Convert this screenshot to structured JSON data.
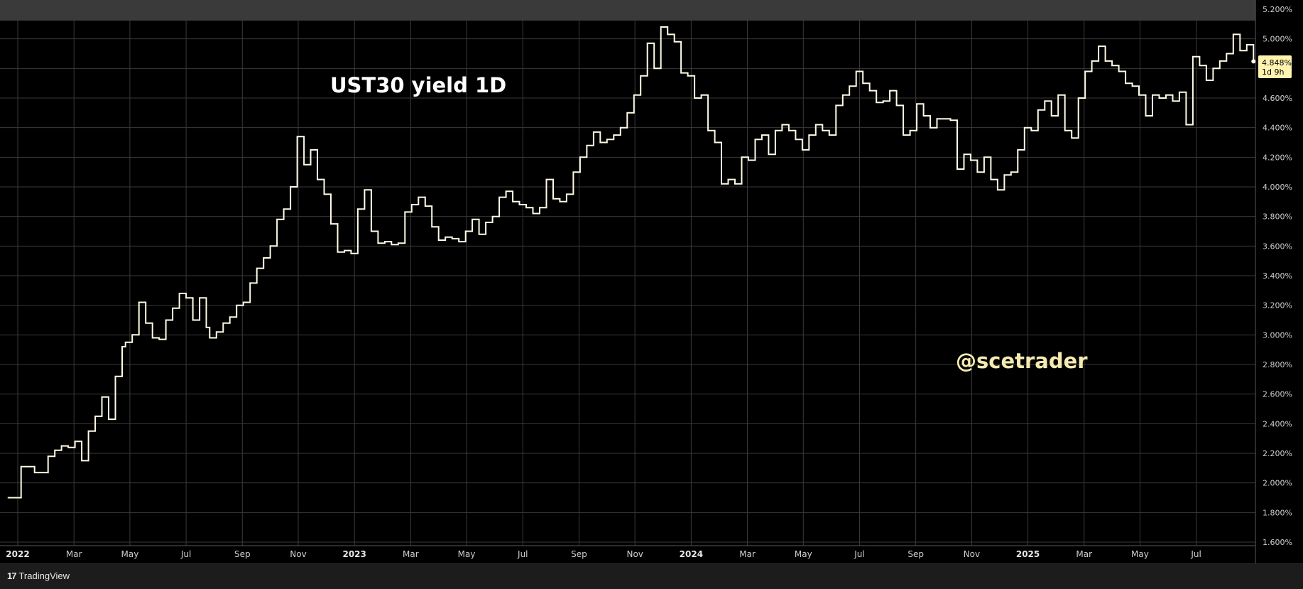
{
  "footer": {
    "brand": "TradingView",
    "brand_mark": "17"
  },
  "price_badge": {
    "value": "4.848%",
    "countdown": "1d 9h",
    "color": "#fff3b0"
  },
  "colors": {
    "background": "#000000",
    "line": "#fffbe6",
    "watermark": "#f5eab0",
    "grid": "#3a3a3a"
  },
  "chart_data": {
    "type": "line",
    "title": "UST30 yield  1D",
    "watermark": "@scetrader",
    "step": true,
    "xlim": [
      2022.0,
      2025.68
    ],
    "ylim": [
      1.6,
      5.2
    ],
    "grid": true,
    "x_ticks": [
      {
        "x": 2022.0,
        "label": "2022",
        "bold": true
      },
      {
        "x": 2022.167,
        "label": "Mar"
      },
      {
        "x": 2022.333,
        "label": "May"
      },
      {
        "x": 2022.5,
        "label": "Jul"
      },
      {
        "x": 2022.667,
        "label": "Sep"
      },
      {
        "x": 2022.833,
        "label": "Nov"
      },
      {
        "x": 2023.0,
        "label": "2023",
        "bold": true
      },
      {
        "x": 2023.167,
        "label": "Mar"
      },
      {
        "x": 2023.333,
        "label": "May"
      },
      {
        "x": 2023.5,
        "label": "Jul"
      },
      {
        "x": 2023.667,
        "label": "Sep"
      },
      {
        "x": 2023.833,
        "label": "Nov"
      },
      {
        "x": 2024.0,
        "label": "2024",
        "bold": true
      },
      {
        "x": 2024.167,
        "label": "Mar"
      },
      {
        "x": 2024.333,
        "label": "May"
      },
      {
        "x": 2024.5,
        "label": "Jul"
      },
      {
        "x": 2024.667,
        "label": "Sep"
      },
      {
        "x": 2024.833,
        "label": "Nov"
      },
      {
        "x": 2025.0,
        "label": "2025",
        "bold": true
      },
      {
        "x": 2025.167,
        "label": "Mar"
      },
      {
        "x": 2025.333,
        "label": "May"
      },
      {
        "x": 2025.5,
        "label": "Jul"
      }
    ],
    "y_ticks": [
      "1.600%",
      "1.800%",
      "2.000%",
      "2.200%",
      "2.400%",
      "2.600%",
      "2.800%",
      "3.000%",
      "3.200%",
      "3.400%",
      "3.600%",
      "3.800%",
      "4.000%",
      "4.200%",
      "4.400%",
      "4.600%",
      "4.800%",
      "5.000%",
      "5.200%"
    ],
    "series": [
      {
        "values": [
          [
            2021.97,
            1.9
          ],
          [
            2022.01,
            2.11
          ],
          [
            2022.05,
            2.07
          ],
          [
            2022.09,
            2.18
          ],
          [
            2022.11,
            2.22
          ],
          [
            2022.13,
            2.25
          ],
          [
            2022.15,
            2.24
          ],
          [
            2022.17,
            2.28
          ],
          [
            2022.19,
            2.15
          ],
          [
            2022.21,
            2.35
          ],
          [
            2022.23,
            2.45
          ],
          [
            2022.25,
            2.58
          ],
          [
            2022.27,
            2.43
          ],
          [
            2022.29,
            2.72
          ],
          [
            2022.31,
            2.92
          ],
          [
            2022.32,
            2.95
          ],
          [
            2022.34,
            3.0
          ],
          [
            2022.36,
            3.22
          ],
          [
            2022.38,
            3.08
          ],
          [
            2022.4,
            2.98
          ],
          [
            2022.42,
            2.97
          ],
          [
            2022.44,
            3.1
          ],
          [
            2022.46,
            3.18
          ],
          [
            2022.48,
            3.28
          ],
          [
            2022.5,
            3.25
          ],
          [
            2022.52,
            3.1
          ],
          [
            2022.54,
            3.25
          ],
          [
            2022.56,
            3.05
          ],
          [
            2022.57,
            2.98
          ],
          [
            2022.59,
            3.02
          ],
          [
            2022.61,
            3.08
          ],
          [
            2022.63,
            3.12
          ],
          [
            2022.65,
            3.2
          ],
          [
            2022.67,
            3.22
          ],
          [
            2022.69,
            3.35
          ],
          [
            2022.71,
            3.45
          ],
          [
            2022.73,
            3.52
          ],
          [
            2022.75,
            3.6
          ],
          [
            2022.77,
            3.78
          ],
          [
            2022.79,
            3.85
          ],
          [
            2022.81,
            4.0
          ],
          [
            2022.83,
            4.34
          ],
          [
            2022.85,
            4.15
          ],
          [
            2022.87,
            4.25
          ],
          [
            2022.89,
            4.05
          ],
          [
            2022.91,
            3.95
          ],
          [
            2022.93,
            3.75
          ],
          [
            2022.95,
            3.56
          ],
          [
            2022.97,
            3.57
          ],
          [
            2022.99,
            3.55
          ],
          [
            2023.01,
            3.85
          ],
          [
            2023.03,
            3.98
          ],
          [
            2023.05,
            3.7
          ],
          [
            2023.07,
            3.62
          ],
          [
            2023.09,
            3.63
          ],
          [
            2023.11,
            3.61
          ],
          [
            2023.13,
            3.62
          ],
          [
            2023.15,
            3.83
          ],
          [
            2023.17,
            3.88
          ],
          [
            2023.19,
            3.93
          ],
          [
            2023.21,
            3.87
          ],
          [
            2023.23,
            3.73
          ],
          [
            2023.25,
            3.64
          ],
          [
            2023.27,
            3.66
          ],
          [
            2023.29,
            3.65
          ],
          [
            2023.31,
            3.63
          ],
          [
            2023.33,
            3.7
          ],
          [
            2023.35,
            3.78
          ],
          [
            2023.37,
            3.68
          ],
          [
            2023.39,
            3.76
          ],
          [
            2023.41,
            3.8
          ],
          [
            2023.43,
            3.93
          ],
          [
            2023.45,
            3.97
          ],
          [
            2023.47,
            3.9
          ],
          [
            2023.49,
            3.88
          ],
          [
            2023.51,
            3.86
          ],
          [
            2023.53,
            3.82
          ],
          [
            2023.55,
            3.86
          ],
          [
            2023.57,
            4.05
          ],
          [
            2023.59,
            3.92
          ],
          [
            2023.61,
            3.9
          ],
          [
            2023.63,
            3.95
          ],
          [
            2023.65,
            4.1
          ],
          [
            2023.67,
            4.2
          ],
          [
            2023.69,
            4.28
          ],
          [
            2023.71,
            4.37
          ],
          [
            2023.73,
            4.3
          ],
          [
            2023.75,
            4.32
          ],
          [
            2023.77,
            4.35
          ],
          [
            2023.79,
            4.4
          ],
          [
            2023.81,
            4.5
          ],
          [
            2023.83,
            4.62
          ],
          [
            2023.85,
            4.75
          ],
          [
            2023.87,
            4.97
          ],
          [
            2023.89,
            4.8
          ],
          [
            2023.91,
            5.08
          ],
          [
            2023.93,
            5.03
          ],
          [
            2023.95,
            4.98
          ],
          [
            2023.97,
            4.77
          ],
          [
            2023.99,
            4.75
          ],
          [
            2024.01,
            4.6
          ],
          [
            2024.03,
            4.62
          ],
          [
            2024.05,
            4.38
          ],
          [
            2024.07,
            4.3
          ],
          [
            2024.09,
            4.02
          ],
          [
            2024.11,
            4.05
          ],
          [
            2024.13,
            4.02
          ],
          [
            2024.15,
            4.2
          ],
          [
            2024.17,
            4.18
          ],
          [
            2024.19,
            4.32
          ],
          [
            2024.21,
            4.35
          ],
          [
            2024.23,
            4.22
          ],
          [
            2024.25,
            4.38
          ],
          [
            2024.27,
            4.42
          ],
          [
            2024.29,
            4.38
          ],
          [
            2024.31,
            4.32
          ],
          [
            2024.33,
            4.25
          ],
          [
            2024.35,
            4.35
          ],
          [
            2024.37,
            4.42
          ],
          [
            2024.39,
            4.38
          ],
          [
            2024.41,
            4.35
          ],
          [
            2024.43,
            4.55
          ],
          [
            2024.45,
            4.62
          ],
          [
            2024.47,
            4.68
          ],
          [
            2024.49,
            4.78
          ],
          [
            2024.51,
            4.7
          ],
          [
            2024.53,
            4.65
          ],
          [
            2024.55,
            4.57
          ],
          [
            2024.57,
            4.58
          ],
          [
            2024.59,
            4.65
          ],
          [
            2024.61,
            4.55
          ],
          [
            2024.63,
            4.35
          ],
          [
            2024.65,
            4.38
          ],
          [
            2024.67,
            4.56
          ],
          [
            2024.69,
            4.48
          ],
          [
            2024.71,
            4.4
          ],
          [
            2024.73,
            4.46
          ],
          [
            2024.75,
            4.46
          ],
          [
            2024.77,
            4.45
          ],
          [
            2024.79,
            4.12
          ],
          [
            2024.81,
            4.22
          ],
          [
            2024.83,
            4.18
          ],
          [
            2024.85,
            4.1
          ],
          [
            2024.87,
            4.2
          ],
          [
            2024.89,
            4.05
          ],
          [
            2024.91,
            3.98
          ],
          [
            2024.93,
            4.08
          ],
          [
            2024.95,
            4.1
          ],
          [
            2024.97,
            4.25
          ],
          [
            2024.99,
            4.4
          ],
          [
            2025.01,
            4.38
          ],
          [
            2025.03,
            4.52
          ],
          [
            2025.05,
            4.58
          ],
          [
            2025.07,
            4.48
          ],
          [
            2025.09,
            4.62
          ],
          [
            2025.11,
            4.38
          ],
          [
            2025.13,
            4.33
          ],
          [
            2025.15,
            4.6
          ],
          [
            2025.17,
            4.78
          ],
          [
            2025.19,
            4.85
          ],
          [
            2025.21,
            4.95
          ],
          [
            2025.23,
            4.85
          ],
          [
            2025.25,
            4.82
          ],
          [
            2025.27,
            4.78
          ],
          [
            2025.29,
            4.7
          ],
          [
            2025.31,
            4.68
          ],
          [
            2025.33,
            4.62
          ],
          [
            2025.35,
            4.48
          ],
          [
            2025.37,
            4.62
          ],
          [
            2025.39,
            4.6
          ],
          [
            2025.41,
            4.62
          ],
          [
            2025.43,
            4.58
          ],
          [
            2025.45,
            4.64
          ],
          [
            2025.47,
            4.42
          ],
          [
            2025.49,
            4.88
          ],
          [
            2025.51,
            4.82
          ],
          [
            2025.53,
            4.72
          ],
          [
            2025.55,
            4.8
          ],
          [
            2025.57,
            4.85
          ],
          [
            2025.59,
            4.9
          ],
          [
            2025.61,
            5.03
          ],
          [
            2025.63,
            4.92
          ],
          [
            2025.65,
            4.96
          ],
          [
            2025.67,
            4.848
          ]
        ]
      }
    ]
  }
}
